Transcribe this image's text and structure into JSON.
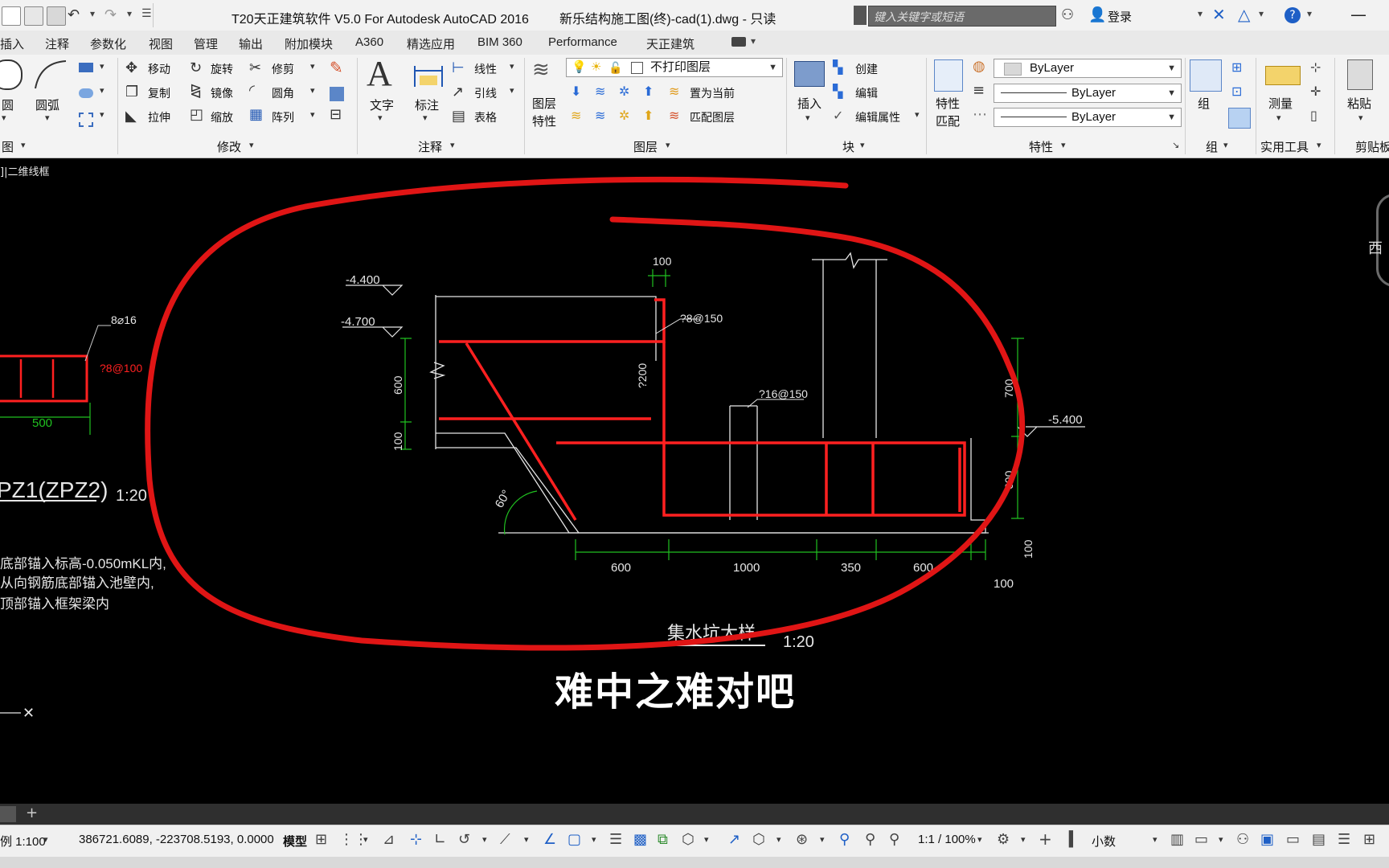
{
  "window": {
    "app_title": "T20天正建筑软件 V5.0 For Autodesk AutoCAD 2016",
    "file_title": "新乐结构施工图(终)-cad(1).dwg - 只读",
    "search_placeholder": "键入关键字或短语",
    "login_label": "登录"
  },
  "menu": [
    "插入",
    "注释",
    "参数化",
    "视图",
    "管理",
    "输出",
    "附加模块",
    "A360",
    "精选应用",
    "BIM 360",
    "Performance",
    "天正建筑"
  ],
  "ribbon": {
    "draw": {
      "circle": "圆",
      "arc": "圆弧",
      "panel": "图"
    },
    "modify": {
      "move": "移动",
      "rotate": "旋转",
      "trim": "修剪",
      "copy": "复制",
      "mirror": "镜像",
      "fillet": "圆角",
      "stretch": "拉伸",
      "scale": "缩放",
      "array": "阵列",
      "panel": "修改"
    },
    "annotation": {
      "text": "文字",
      "dimension": "标注",
      "linear": "线性",
      "leader": "引线",
      "table": "表格",
      "panel": "注释"
    },
    "layers": {
      "layer_props_1": "图层",
      "layer_props_2": "特性",
      "layer_combo": "不打印图层",
      "set_current": "置为当前",
      "match_layer": "匹配图层",
      "panel": "图层"
    },
    "block": {
      "insert": "插入",
      "create": "创建",
      "edit": "编辑",
      "edit_attr": "编辑属性",
      "panel": "块"
    },
    "properties": {
      "match_1": "特性",
      "match_2": "匹配",
      "color": "ByLayer",
      "linetype": "ByLayer",
      "lineweight": "ByLayer",
      "panel": "特性"
    },
    "groups": {
      "group": "组",
      "panel": "组"
    },
    "utilities": {
      "measure": "测量",
      "panel": "实用工具"
    },
    "clipboard": {
      "paste": "粘贴",
      "panel": "剪贴板"
    }
  },
  "viewport_label": "]|二维线框",
  "viewcube_label": "西",
  "drawing": {
    "left_detail": {
      "rebar_top": "8⌀16",
      "rebar_stirrup": "?8@100",
      "width": "500"
    },
    "left_notes": {
      "title": "PZ1(ZPZ2)",
      "scale": "1:20",
      "line1": "底部锚入标高-0.050mKL内,",
      "line2": "从向钢筋底部锚入池壁内,",
      "line3": "顶部锚入框架梁内"
    },
    "elev_top": "-4.400",
    "elev_second": "-4.700",
    "elev_right": "-5.400",
    "dim_top": "100",
    "label_rebar_150": "?8@150",
    "label_rebar_200": "?200",
    "label_rebar_16": "?16@150",
    "dim_left_600": "600",
    "dim_left_100": "100",
    "dim_right_700": "700",
    "dim_right_600": "600",
    "dim_right_100": "100",
    "dim_bottom": [
      "600",
      "1000",
      "350",
      "600"
    ],
    "dim_bottom_100": "100",
    "angle": "60°",
    "drawing_title": "集水坑大样",
    "drawing_scale": "1:20"
  },
  "subtitle": "难中之难对吧",
  "status": {
    "scale": "例 1:100",
    "coords": "386721.6089, -223708.5193, 0.0000",
    "model": "模型",
    "annoscale": "1:1 / 100%",
    "units": "小数"
  },
  "colors": {
    "accent_red": "#e01515",
    "dim_green": "#20c020",
    "ink_red": "#ff2020"
  }
}
